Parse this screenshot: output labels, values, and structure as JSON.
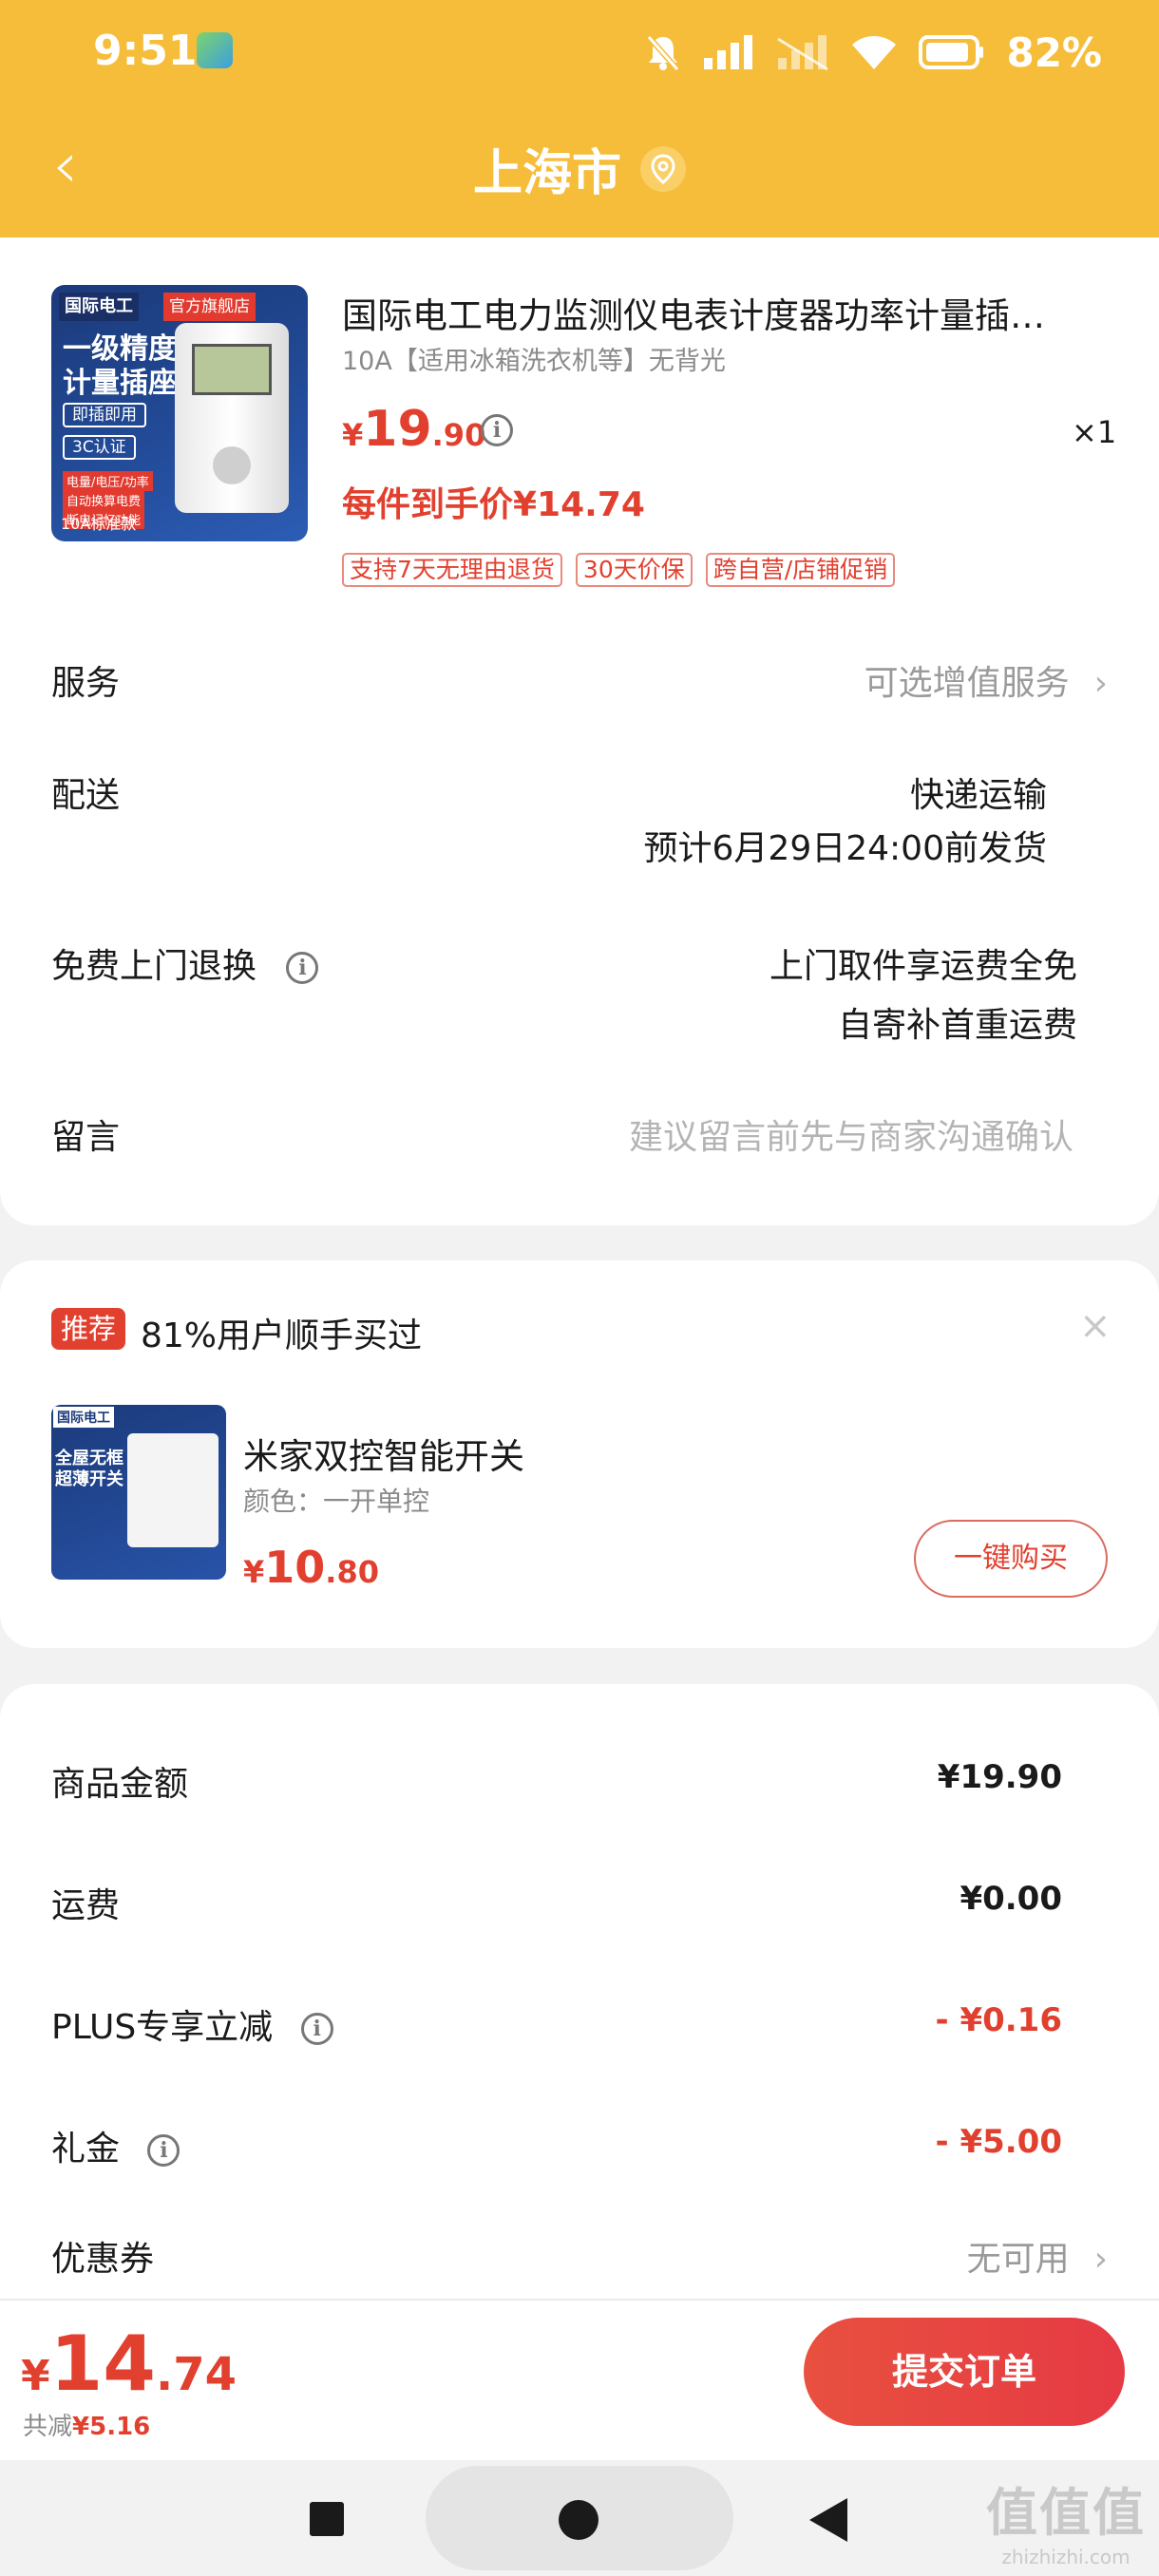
{
  "status_bar": {
    "time": "9:51",
    "battery_text": "82%"
  },
  "nav": {
    "back_glyph": "‹",
    "title": "上海市"
  },
  "product": {
    "title": "国际电工电力监测仪电表计度器功率计量插…",
    "spec": "10A【适用冰箱洗衣机等】无背光",
    "price_currency": "¥",
    "price_int": "19",
    "price_dec": ".90",
    "quantity": "×1",
    "net_price": "每件到手价¥14.74",
    "tags": [
      "支持7天无理由退货",
      "30天价保",
      "跨自营/店铺促销"
    ],
    "image": {
      "brand": "国际电工",
      "store": "官方旗舰店",
      "headline1": "一级精度",
      "headline2": "计量插座",
      "badge1": "即插即用",
      "badge2": "3C认证",
      "mini1": "电量/电压/功率",
      "mini2": "自动换算电费",
      "mini3": "断电记忆功能",
      "footer": "10A标准款"
    }
  },
  "rows": {
    "service_label": "服务",
    "service_value": "可选增值服务",
    "delivery_label": "配送",
    "delivery_value1": "快递运输",
    "delivery_value2": "预计6月29日24:00前发货",
    "return_label": "免费上门退换",
    "return_value1": "上门取件享运费全免",
    "return_value2": "自寄补首重运费",
    "message_label": "留言",
    "message_placeholder": "建议留言前先与商家沟通确认"
  },
  "recommend": {
    "badge": "推荐",
    "title": "81%用户顺手买过",
    "close": "×",
    "name": "米家双控智能开关",
    "spec": "颜色：一开单控",
    "price_currency": "¥",
    "price_int": "10",
    "price_dec": ".80",
    "buy_label": "一键购买",
    "image": {
      "brand": "国际电工",
      "headline1": "全屋无框",
      "headline2": "超薄开关"
    }
  },
  "summary": {
    "goods_label": "商品金额",
    "goods_value": "¥19.90",
    "shipping_label": "运费",
    "shipping_value": "¥0.00",
    "plus_label": "PLUS专享立减",
    "plus_value": "- ¥0.16",
    "gift_label": "礼金",
    "gift_value": "- ¥5.00",
    "coupon_label": "优惠券",
    "coupon_value": "无可用"
  },
  "bottom": {
    "total_currency": "¥",
    "total_int": "14",
    "total_dec": ".74",
    "saved_prefix": "共减",
    "saved_value": "¥5.16",
    "submit_label": "提交订单"
  },
  "watermark": {
    "big": "值值值",
    "small": "zhizhizhi.com"
  },
  "colors": {
    "header": "#f6bd3a",
    "accent_red": "#e2402f"
  }
}
